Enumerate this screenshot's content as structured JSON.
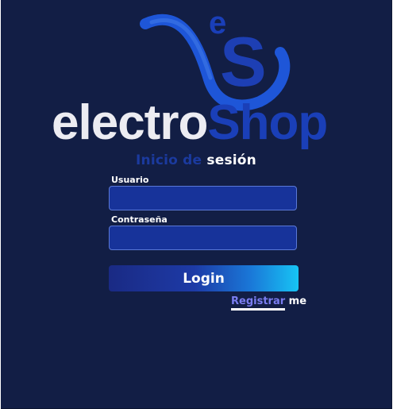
{
  "logo": {
    "badge_letters": "eS",
    "word_part1": "electro",
    "word_part2": "Shop"
  },
  "login": {
    "title_part1": "Inicio de",
    "title_part2": "sesión",
    "username_label": "Usuario",
    "username_value": "",
    "password_label": "Contraseña",
    "password_value": "",
    "login_button": "Login",
    "register_link": "Registrar",
    "register_suffix": "me"
  },
  "colors": {
    "background": "#121e45",
    "accent_blue": "#1b3a9e",
    "input_fill": "#17339a",
    "link_purple": "#7a7df0",
    "button_gradient_end": "#17c4f4"
  }
}
